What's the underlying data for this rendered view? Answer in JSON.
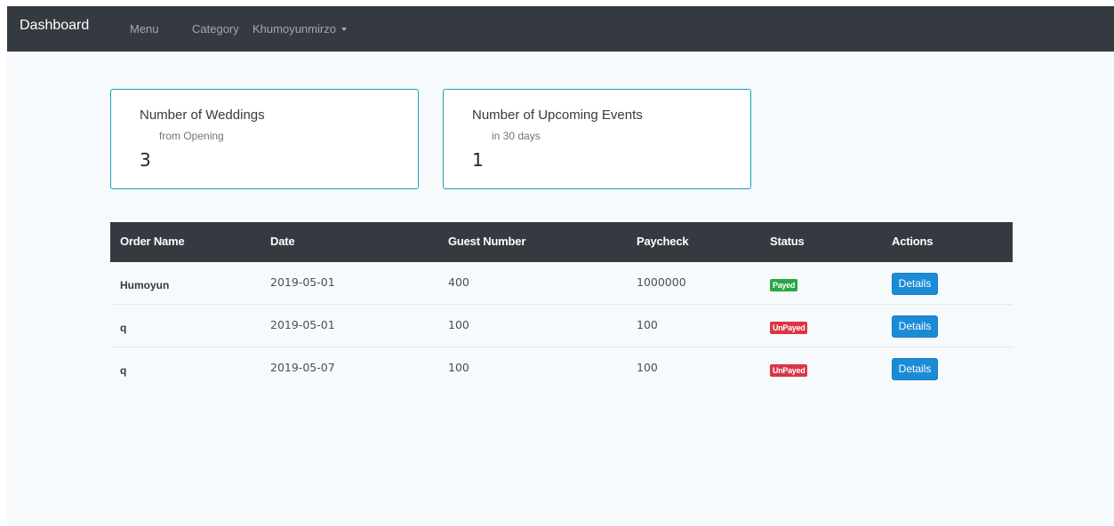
{
  "navbar": {
    "brand": "Dashboard",
    "links": [
      "Menu",
      "Category"
    ],
    "user": "Khumoyunmirzo"
  },
  "cards": [
    {
      "title": "Number of Weddings",
      "subtitle": "from Opening",
      "value": "3"
    },
    {
      "title": "Number of Upcoming Events",
      "subtitle": "in 30 days",
      "value": "1"
    }
  ],
  "table": {
    "headers": [
      "Order Name",
      "Date",
      "Guest Number",
      "Paycheck",
      "Status",
      "Actions"
    ],
    "rows": [
      {
        "name": "Humoyun",
        "date": "2019-05-01",
        "guests": "400",
        "paycheck": "1000000",
        "status": "Payed",
        "action": "Details"
      },
      {
        "name": "q",
        "date": "2019-05-01",
        "guests": "100",
        "paycheck": "100",
        "status": "UnPayed",
        "action": "Details"
      },
      {
        "name": "q",
        "date": "2019-05-07",
        "guests": "100",
        "paycheck": "100",
        "status": "UnPayed",
        "action": "Details"
      }
    ]
  },
  "colors": {
    "navbar": "#343a40",
    "card_border": "#17a2b8",
    "status_paid": "#28a745",
    "status_unpaid": "#dc3545",
    "button": "#1b8bd6"
  }
}
